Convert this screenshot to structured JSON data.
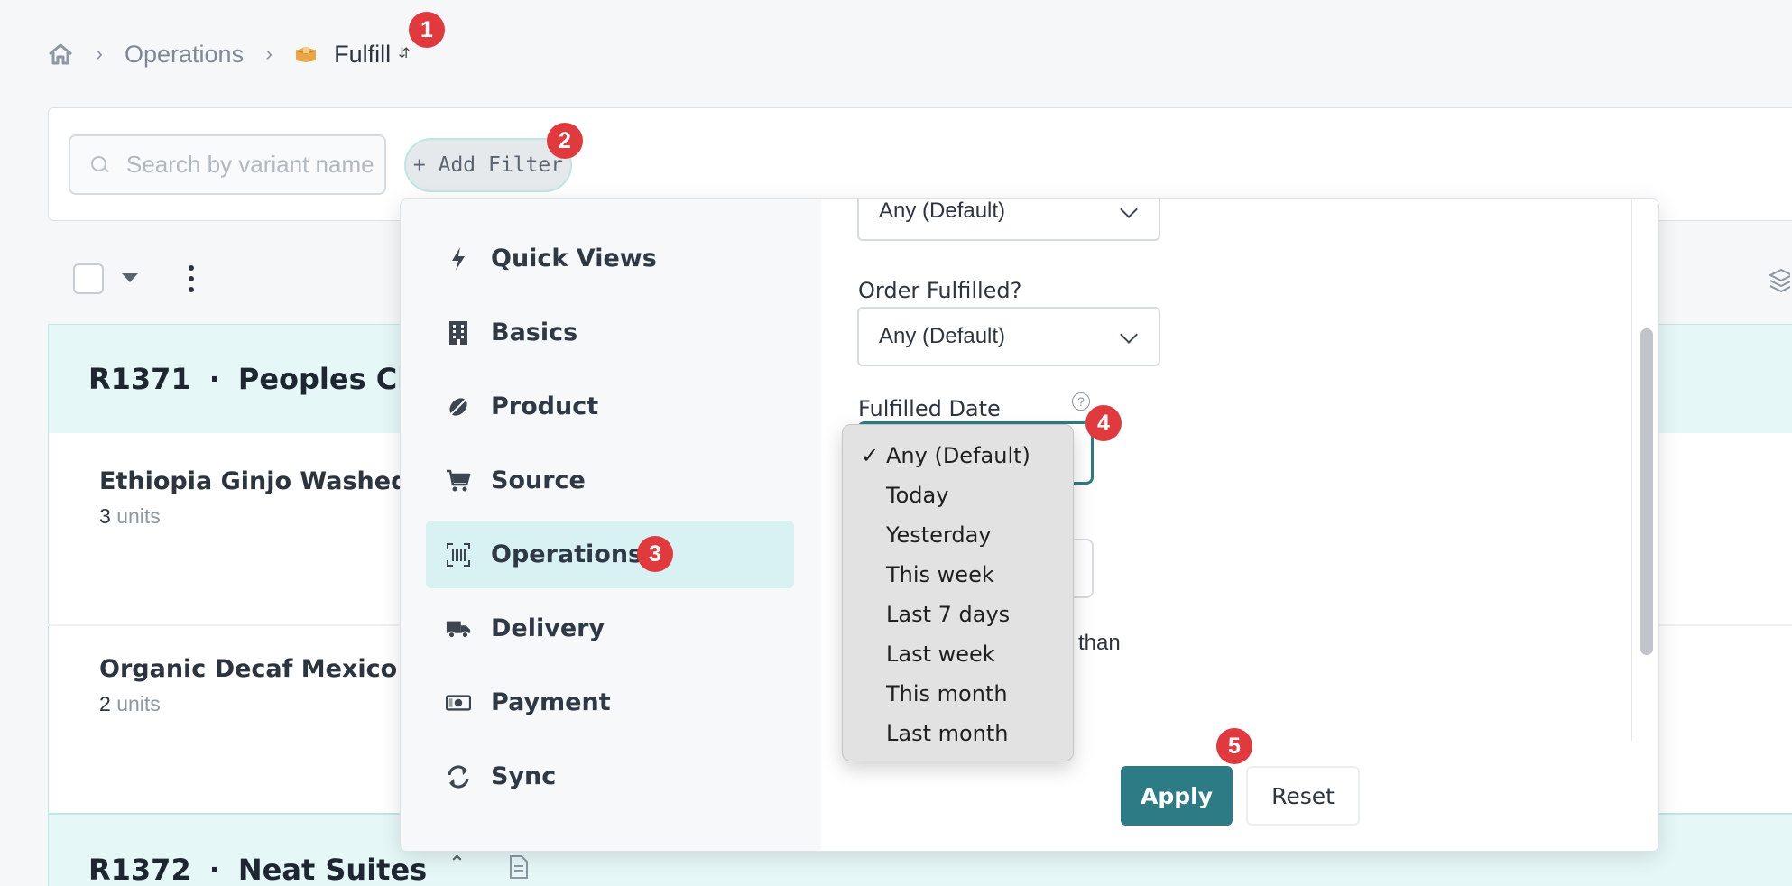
{
  "breadcrumb": {
    "home_icon": "home-icon",
    "section": "Operations",
    "current": "Fulfill",
    "current_icon": "box-icon"
  },
  "search": {
    "placeholder": "Search by variant name"
  },
  "add_filter_label": "+ Add Filter",
  "orders": [
    {
      "id": "R1371",
      "name": "Peoples Churc",
      "items": [
        {
          "name": "Ethiopia Ginjo Washed",
          "qty": "3",
          "unit": "units"
        },
        {
          "name": "Organic Decaf Mexico",
          "qty": "2",
          "unit": "units"
        }
      ]
    },
    {
      "id": "R1372",
      "name": "Neat Suites",
      "items": []
    }
  ],
  "filter_nav": [
    {
      "label": "Quick Views",
      "icon": "lightning-icon"
    },
    {
      "label": "Basics",
      "icon": "building-icon"
    },
    {
      "label": "Product",
      "icon": "coffee-bean-icon"
    },
    {
      "label": "Source",
      "icon": "cart-icon"
    },
    {
      "label": "Operations",
      "icon": "barcode-icon",
      "active": true
    },
    {
      "label": "Delivery",
      "icon": "truck-icon"
    },
    {
      "label": "Payment",
      "icon": "cash-icon"
    },
    {
      "label": "Sync",
      "icon": "sync-icon"
    }
  ],
  "filter_form": {
    "top_select_value": "Any (Default)",
    "order_fulfilled_label": "Order Fulfilled?",
    "order_fulfilled_value": "Any (Default)",
    "fulfilled_date_label": "Fulfilled Date",
    "partial_text": "than"
  },
  "date_options": {
    "selected": "Any (Default)",
    "items": [
      "Any (Default)",
      "Today",
      "Yesterday",
      "This week",
      "Last 7 days",
      "Last week",
      "This month",
      "Last month"
    ]
  },
  "buttons": {
    "apply": "Apply",
    "reset": "Reset"
  },
  "badges": [
    "1",
    "2",
    "3",
    "4",
    "5"
  ],
  "colors": {
    "accent": "#2d7c85",
    "badge": "#e0393e",
    "active_nav": "#d8f1f2",
    "order_header": "#e5f7f7"
  }
}
